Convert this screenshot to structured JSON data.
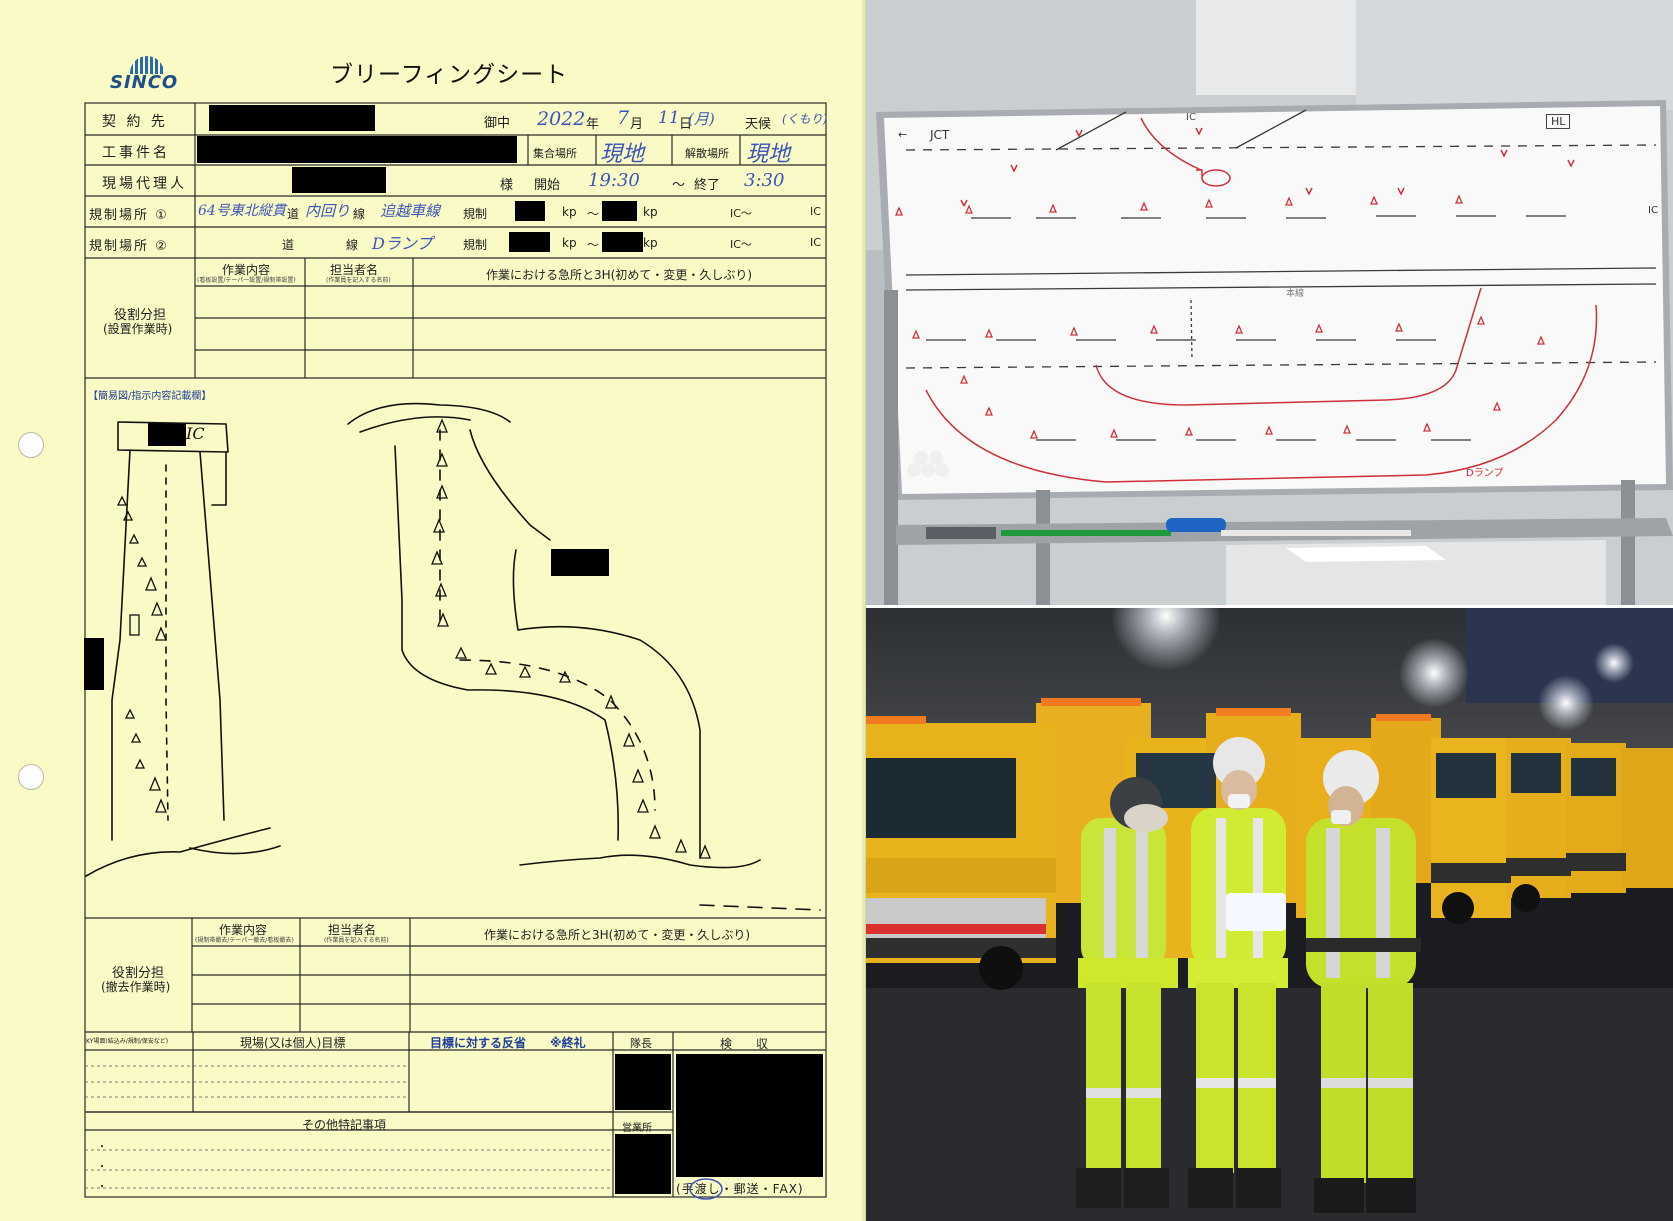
{
  "sheet": {
    "logo_text": "SINCO",
    "title": "ブリーフィングシート",
    "row1": {
      "label": "契 約 先",
      "suffix": "御中",
      "year": "2022",
      "year_unit": "年",
      "month": "7",
      "month_unit": "月",
      "day": "11",
      "day_unit": "日",
      "weekday": "(月)",
      "weather_label": "天候",
      "weather": "(くもり)"
    },
    "row2": {
      "label": "工事件名",
      "assembly_label": "集合場所",
      "assembly_value": "現地",
      "dismissal_label": "解散場所",
      "dismissal_value": "現地"
    },
    "row3": {
      "label": "現場代理人",
      "honorific": "様",
      "start_label": "開始",
      "start_value": "19:30",
      "tilde": "〜",
      "end_label": "終了",
      "end_value": "3:30"
    },
    "row4": {
      "label": "規制場所 ①",
      "route_hw": "64号東北縦貫",
      "road_label": "道",
      "line_hw": "内回り",
      "line_label": "線",
      "lane_hw": "追越車線",
      "reg_label": "規制",
      "kp1": "kp",
      "tilde": "〜",
      "kp2": "kp",
      "ic1": "IC〜",
      "ic2": "IC"
    },
    "row5": {
      "label": "規制場所 ②",
      "road_label": "道",
      "line_label": "線",
      "ramp_hw": "Dランプ",
      "reg_label": "規制",
      "kp1": "kp",
      "tilde": "〜",
      "kp2": "kp",
      "ic1": "IC〜",
      "ic2": "IC"
    },
    "setup": {
      "role_label": "役割分担",
      "role_sub": "(設置作業時)",
      "col_work": "作業内容",
      "col_work_sub": "(看板設置/テーパー設置/規制帯設置)",
      "col_person": "担当者名",
      "col_person_sub": "(作業員を記入する名前)",
      "col_points": "作業における急所と3H(初めて・変更・久しぶり)"
    },
    "diagram": {
      "label": "【簡易図/指示内容記載欄】",
      "ic_text": "IC"
    },
    "removal": {
      "role_label": "役割分担",
      "role_sub": "(撤去作業時)",
      "col_work": "作業内容",
      "col_work_sub": "(規制帯撤去/テーパー撤去/看板撤去)",
      "col_person": "担当者名",
      "col_person_sub": "(作業員を記入する名前)",
      "col_points": "作業における急所と3H(初めて・変更・久しぶり)"
    },
    "bottom": {
      "ky_label": "KY場面(結込み/規制/保安など)",
      "goal_label": "現場(又は個人)目標",
      "reflection_label": "目標に対する反省",
      "end_note": "※終礼",
      "leader_label": "隊長",
      "inspection_label": "検　　収",
      "notes_label": "その他特記事項",
      "office_label": "営業所",
      "bullets": [
        "・",
        "・",
        "・"
      ],
      "delivery": "(手渡し・郵送・FAX)"
    }
  },
  "whiteboard": {
    "jct_label": "JCT",
    "arrow_label": "←",
    "top_ic_label": "IC",
    "mid_label": "本線",
    "right_top_label": "HL",
    "right_side_label": "IC",
    "ramp_label": "Dランプ"
  },
  "colors": {
    "sheet_bg": "#fafac6",
    "ink": "#222222",
    "handwriting_blue": "#3d55b8",
    "marker_red": "#d0303a",
    "truck_yellow": "#f0b418",
    "vest_yellow": "#d7f02a"
  }
}
